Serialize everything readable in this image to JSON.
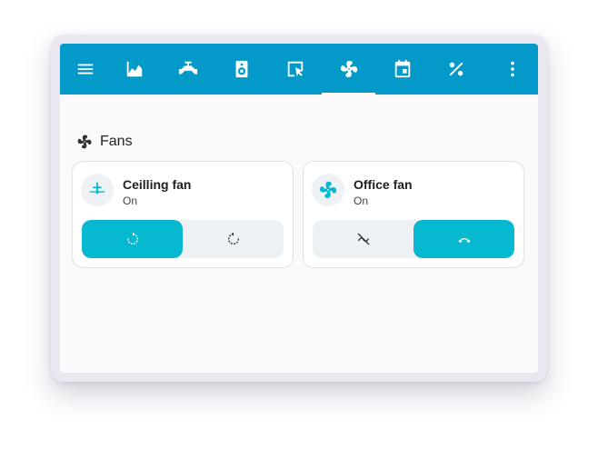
{
  "toolbar": {
    "items": [
      {
        "icon": "menu-icon",
        "label": "Menu"
      },
      {
        "icon": "area-chart-icon",
        "label": "Energy"
      },
      {
        "icon": "water-valve-icon",
        "label": "Valves"
      },
      {
        "icon": "speaker-icon",
        "label": "Media"
      },
      {
        "icon": "cursor-select-icon",
        "label": "Select"
      },
      {
        "icon": "fan-icon",
        "label": "Fans",
        "active": true
      },
      {
        "icon": "calendar-icon",
        "label": "Calendar"
      },
      {
        "icon": "percent-icon",
        "label": "Percent"
      },
      {
        "icon": "more-vert-icon",
        "label": "More"
      }
    ],
    "accent": "#0399c9"
  },
  "section": {
    "title": "Fans",
    "icon": "fan-icon"
  },
  "cards": [
    {
      "name": "Ceilling fan",
      "state": "On",
      "icon": "ceiling-fan-icon",
      "buttons": [
        {
          "icon": "rotate-right-icon",
          "active": true
        },
        {
          "icon": "rotate-left-icon",
          "active": false
        }
      ]
    },
    {
      "name": "Office fan",
      "state": "On",
      "icon": "fan-icon",
      "buttons": [
        {
          "icon": "oscillation-off-icon",
          "active": false
        },
        {
          "icon": "oscillation-icon",
          "active": true
        }
      ]
    }
  ],
  "colors": {
    "active_button": "#06b8d0",
    "inactive_button": "#eef1f3",
    "card_icon_fan": "#06b8d0"
  }
}
